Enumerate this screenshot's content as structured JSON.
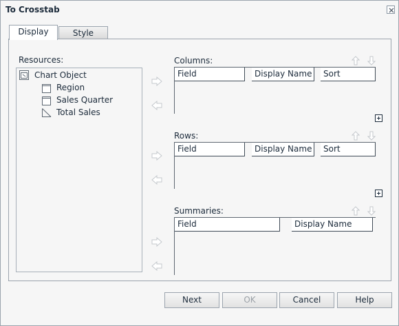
{
  "dialog": {
    "title": "To Crosstab"
  },
  "tabs": [
    {
      "label": "Display",
      "selected": true
    },
    {
      "label": "Style",
      "selected": false
    }
  ],
  "resources": {
    "label": "Resources:",
    "root": "Chart Object",
    "children": [
      "Region",
      "Sales Quarter",
      "Total Sales"
    ]
  },
  "columns": {
    "label": "Columns:",
    "headers": [
      "Field",
      "Display Name",
      "Sort"
    ]
  },
  "rows": {
    "label": "Rows:",
    "headers": [
      "Field",
      "Display Name",
      "Sort"
    ]
  },
  "summaries": {
    "label": "Summaries:",
    "headers": [
      "Field",
      "Display Name"
    ]
  },
  "buttons": {
    "next": "Next",
    "ok": "OK",
    "ok_enabled": false,
    "cancel": "Cancel",
    "help": "Help"
  },
  "colors": {
    "accent_border": "#9aa3ad",
    "text": "#1b2a3a",
    "arrow_gray": "#c4c8cc",
    "disabled_text": "#9aa0a6"
  }
}
